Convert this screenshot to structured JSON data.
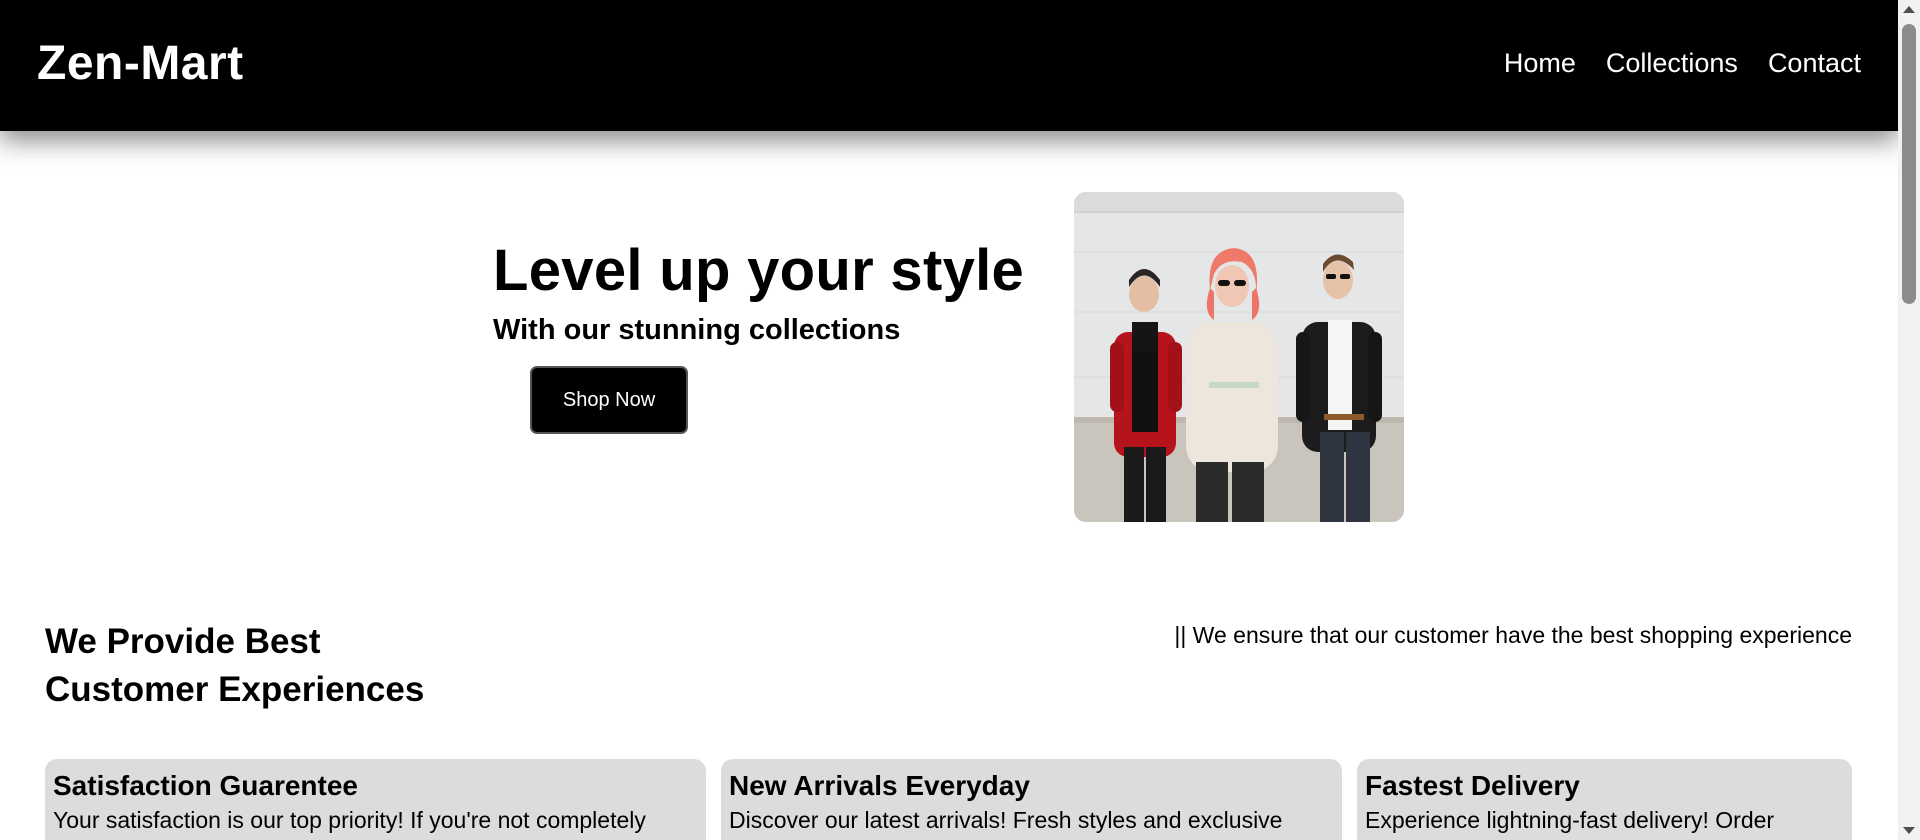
{
  "header": {
    "brand": "Zen-Mart",
    "nav": [
      "Home",
      "Collections",
      "Contact"
    ],
    "background": "#000000"
  },
  "hero": {
    "title": "Level up your style",
    "subtitle": "With our stunning collections",
    "cta_label": "Shop Now",
    "image": "fashion-group-photo"
  },
  "section": {
    "heading_line1": "We Provide Best",
    "heading_line2": "Customer Experiences",
    "note": "|| We ensure that our customer have the best shopping experience"
  },
  "features": [
    {
      "title": "Satisfaction Guarentee",
      "text": "Your satisfaction is our top priority! If you're not completely"
    },
    {
      "title": "New Arrivals Everyday",
      "text": "Discover our latest arrivals! Fresh styles and exclusive"
    },
    {
      "title": "Fastest Delivery",
      "text": "Experience lightning-fast delivery! Order"
    }
  ],
  "colors": {
    "accent": "#000000",
    "card_background": "#dcdcdc"
  }
}
